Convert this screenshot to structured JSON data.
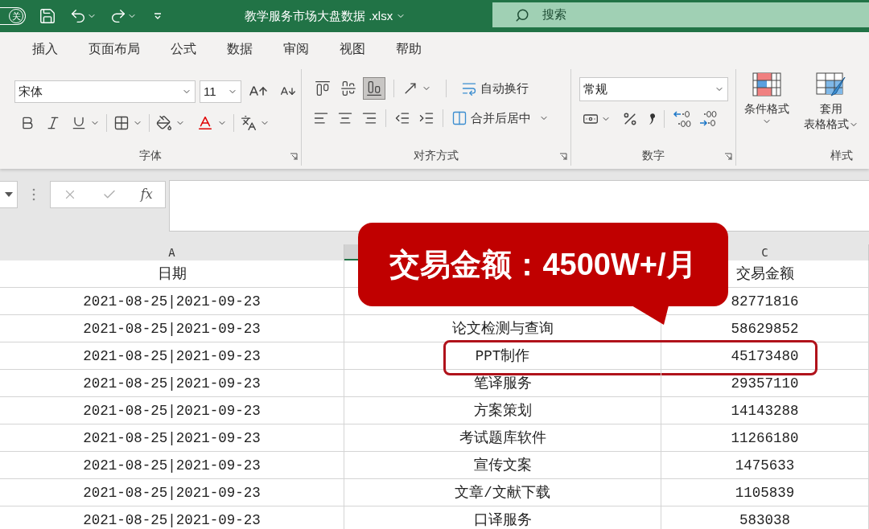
{
  "title_bar": {
    "autosave_label": "关",
    "file_name": "教学服务市场大盘数据 .xlsx",
    "search_placeholder": "搜索"
  },
  "ribbon_tabs": [
    {
      "label": "插入"
    },
    {
      "label": "页面布局"
    },
    {
      "label": "公式"
    },
    {
      "label": "数据"
    },
    {
      "label": "审阅"
    },
    {
      "label": "视图"
    },
    {
      "label": "帮助"
    }
  ],
  "ribbon": {
    "font_name": "宋体",
    "font_size": "11",
    "font_group": "字体",
    "vertical_align": [
      {
        "selected": false
      },
      {
        "selected": false
      },
      {
        "selected": true
      }
    ],
    "wrap_text": "自动换行",
    "merge_center": "合并后居中",
    "alignment_group": "对齐方式",
    "number_format": "常规",
    "number_group": "数字",
    "conditional_format": "条件格式",
    "table_format": [
      "套用",
      "表格格式"
    ],
    "styles_group": "样式"
  },
  "formula_bar": {
    "function_label": "fx"
  },
  "sheet": {
    "columns": [
      {
        "letter": "A",
        "selected": false
      },
      {
        "selected": true
      },
      {
        "letter": "C",
        "selected": false
      }
    ],
    "rows": [
      {
        "cells": [
          "日期",
          null,
          "交易金额"
        ],
        "circled": false
      },
      {
        "cells": [
          "2021-08-25|2021-09-23",
          null,
          "82771816"
        ],
        "circled": false
      },
      {
        "cells": [
          "2021-08-25|2021-09-23",
          "论文检测与查询",
          "58629852"
        ],
        "circled": false
      },
      {
        "cells": [
          "2021-08-25|2021-09-23",
          "PPT制作",
          "45173480"
        ],
        "circled": true
      },
      {
        "cells": [
          "2021-08-25|2021-09-23",
          "笔译服务",
          "29357110"
        ],
        "circled": false
      },
      {
        "cells": [
          "2021-08-25|2021-09-23",
          "方案策划",
          "14143288"
        ],
        "circled": false
      },
      {
        "cells": [
          "2021-08-25|2021-09-23",
          "考试题库软件",
          "11266180"
        ],
        "circled": false
      },
      {
        "cells": [
          "2021-08-25|2021-09-23",
          "宣传文案",
          "1475633"
        ],
        "circled": false
      },
      {
        "cells": [
          "2021-08-25|2021-09-23",
          "文章/文献下载",
          "1105839"
        ],
        "circled": false
      },
      {
        "cells": [
          "2021-08-25|2021-09-23",
          "口译服务",
          "583038"
        ],
        "circled": false
      }
    ]
  },
  "callout": {
    "text": "交易金额：4500W+/月"
  }
}
